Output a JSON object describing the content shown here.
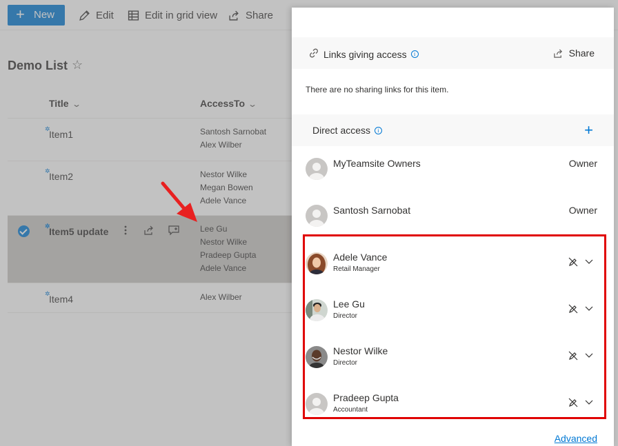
{
  "commandbar": {
    "new_label": "New",
    "edit_label": "Edit",
    "grid_label": "Edit in grid view",
    "share_label": "Share"
  },
  "list": {
    "title": "Demo List",
    "columns": {
      "title": "Title",
      "access_to": "AccessTo"
    },
    "rows": [
      {
        "title": "Item1",
        "access": "Santosh Sarnobat\nAlex Wilber",
        "selected": false
      },
      {
        "title": "Item2",
        "access": "Nestor Wilke\nMegan Bowen\nAdele Vance",
        "selected": false
      },
      {
        "title": "Item5 update",
        "access": "Lee Gu\nNestor Wilke\nPradeep Gupta\nAdele Vance",
        "selected": true
      },
      {
        "title": "Item4",
        "access": "Alex Wilber",
        "selected": false
      }
    ]
  },
  "panel": {
    "links_section": {
      "label": "Links giving access",
      "share_label": "Share",
      "empty_text": "There are no sharing links for this item."
    },
    "direct_section": {
      "label": "Direct access"
    },
    "people": [
      {
        "name": "MyTeamsite Owners",
        "role": "",
        "permission": "Owner",
        "avatar": "default-person"
      },
      {
        "name": "Santosh Sarnobat",
        "role": "",
        "permission": "Owner",
        "avatar": "default-person"
      },
      {
        "name": "Adele Vance",
        "role": "Retail Manager",
        "permission": "",
        "avatar": "photo"
      },
      {
        "name": "Lee Gu",
        "role": "Director",
        "permission": "",
        "avatar": "photo"
      },
      {
        "name": "Nestor Wilke",
        "role": "Director",
        "permission": "",
        "avatar": "photo"
      },
      {
        "name": "Pradeep Gupta",
        "role": "Accountant",
        "permission": "",
        "avatar": "default-person"
      }
    ],
    "advanced_label": "Advanced"
  },
  "colors": {
    "accent": "#0078d4",
    "highlight_box": "#e00000",
    "annotation_arrow": "#e82020",
    "overlay": "#787878"
  },
  "icons": {
    "new": "plus-icon",
    "edit": "pencil-icon",
    "grid": "grid-icon",
    "share": "share-icon",
    "link": "link-icon",
    "info": "info-icon",
    "add": "plus-icon",
    "edit_off": "no-edit-icon",
    "expand": "chevron-down-icon"
  }
}
